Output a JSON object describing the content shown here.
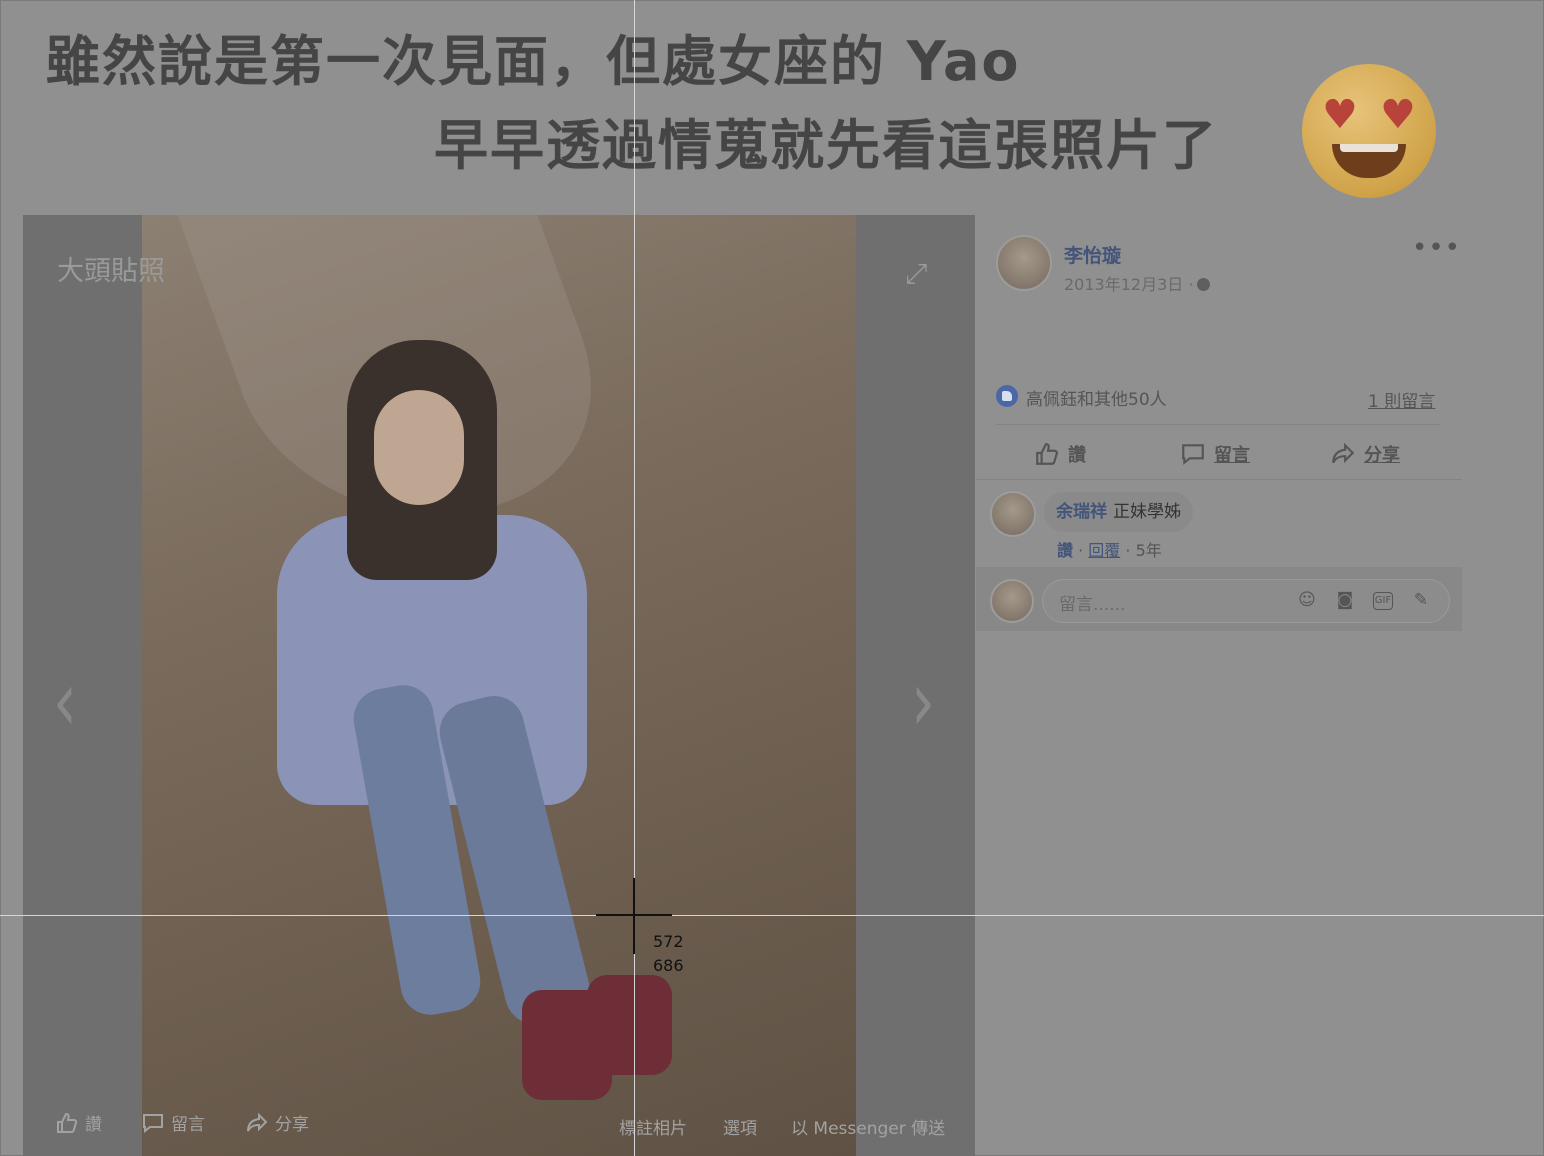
{
  "caption": {
    "line1": "雖然說是第一次見面，但處女座的 Yao",
    "line2": "早早透過情蒐就先看這張照片了"
  },
  "viewer": {
    "title": "大頭貼照",
    "actions": [
      {
        "label": "讚",
        "icon": "thumbs-up-icon"
      },
      {
        "label": "留言",
        "icon": "comment-icon"
      },
      {
        "label": "分享",
        "icon": "share-icon"
      }
    ],
    "options": [
      "標註相片",
      "選項",
      "以 Messenger 傳送"
    ]
  },
  "post": {
    "author": "李怡璇",
    "date": "2013年12月3日 ·",
    "reactors": "高佩鈺和其他50人",
    "comments_count": "1 則留言",
    "actions": [
      {
        "label": "讚",
        "icon": "thumbs-up-icon"
      },
      {
        "label": "留言",
        "icon": "comment-icon"
      },
      {
        "label": "分享",
        "icon": "share-icon"
      }
    ],
    "comment": {
      "author": "余瑞祥",
      "text": "正妹學姊",
      "like": "讚",
      "reply": "回覆",
      "age": "5年"
    },
    "composer_placeholder": "留言......"
  },
  "cursor_readout": {
    "x": "572",
    "y": "686"
  },
  "colors": {
    "overlay": "#909090",
    "link": "#43557a",
    "like_badge": "#4b67a8"
  }
}
